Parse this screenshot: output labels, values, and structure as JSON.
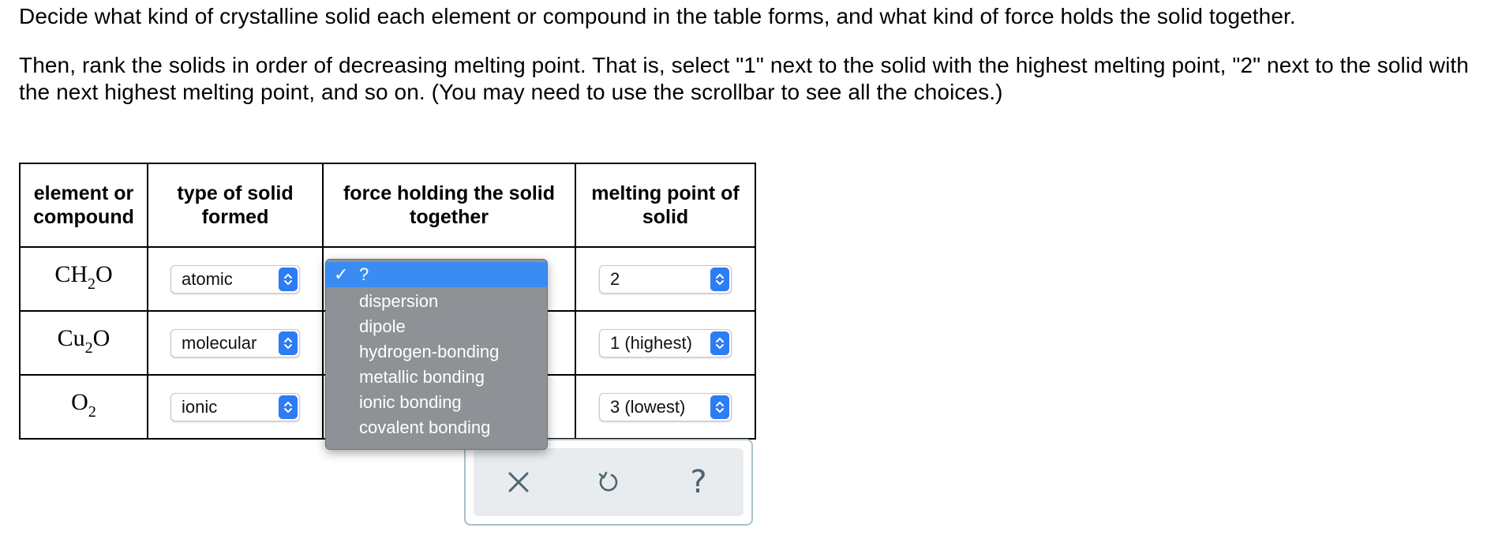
{
  "instructions": {
    "line1": "Decide what kind of crystalline solid each element or compound in the table forms, and what kind of force holds the solid together.",
    "line2": "Then, rank the solids in order of decreasing melting point. That is, select \"1\" next to the solid with the highest melting point, \"2\" next to the solid with the next highest melting point, and so on. (You may need to use the scrollbar to see all the choices.)"
  },
  "table": {
    "headers": {
      "col1": "element or compound",
      "col2": "type of solid formed",
      "col3": "force holding the solid together",
      "col4": "melting point of solid"
    },
    "rows": [
      {
        "formula_a": "CH",
        "formula_sub": "2",
        "formula_b": "O",
        "type": "atomic",
        "melting_point": "2"
      },
      {
        "formula_a": "Cu",
        "formula_sub": "2",
        "formula_b": "O",
        "type": "molecular",
        "melting_point": "1 (highest)"
      },
      {
        "formula_a": "O",
        "formula_sub": "2",
        "formula_b": "",
        "type": "ionic",
        "melting_point": "3 (lowest)"
      }
    ]
  },
  "force_dropdown": {
    "selected": "?",
    "check_mark": "✓",
    "options": [
      "dispersion",
      "dipole",
      "hydrogen-bonding",
      "metallic bonding",
      "ionic bonding",
      "covalent bonding"
    ]
  },
  "toolbar": {
    "icons": [
      "close-icon",
      "undo-icon",
      "help-icon"
    ],
    "help_glyph": "?"
  },
  "colors": {
    "accent_blue": "#2e7bf6",
    "selected_option": "#3a8cf2",
    "popup_bg": "#8e9296",
    "toolbar_border": "#a8c0c8",
    "toolbar_bg": "#e8ecef",
    "icon_color": "#4f6470"
  }
}
